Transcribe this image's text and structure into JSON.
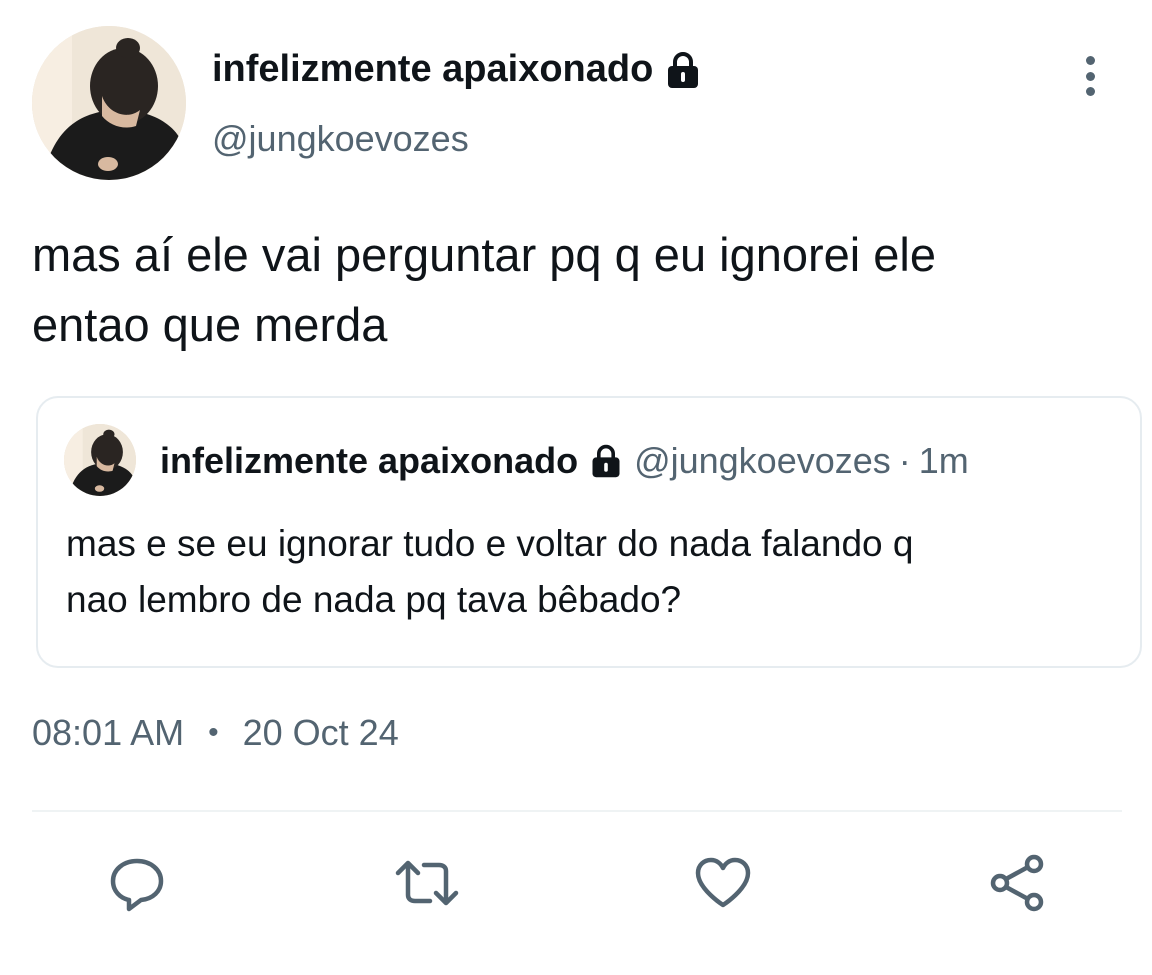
{
  "tweet": {
    "author": {
      "display_name": "infelizmente apaixonado",
      "handle": "@jungkoevozes",
      "protected": true
    },
    "text_lines": [
      "mas aí ele vai perguntar pq q eu ignorei ele",
      "entao que merda"
    ],
    "time": "08:01 AM",
    "separator": "•",
    "date": "20 Oct 24"
  },
  "quoted_tweet": {
    "author": {
      "display_name": "infelizmente apaixonado",
      "handle": "@jungkoevozes",
      "protected": true
    },
    "separator": "·",
    "relative_time": "1m",
    "text_lines": [
      "mas e se eu ignorar tudo e voltar do nada falando q",
      "nao lembro de nada pq tava bêbado?"
    ]
  },
  "icons": {
    "menu": "more-vertical-icon",
    "lock": "lock-icon",
    "actions": [
      "reply-icon",
      "retweet-icon",
      "like-icon",
      "share-icon"
    ]
  },
  "colors": {
    "text": "#0f1419",
    "secondary_text": "#536471",
    "border": "#e6ecf0"
  }
}
